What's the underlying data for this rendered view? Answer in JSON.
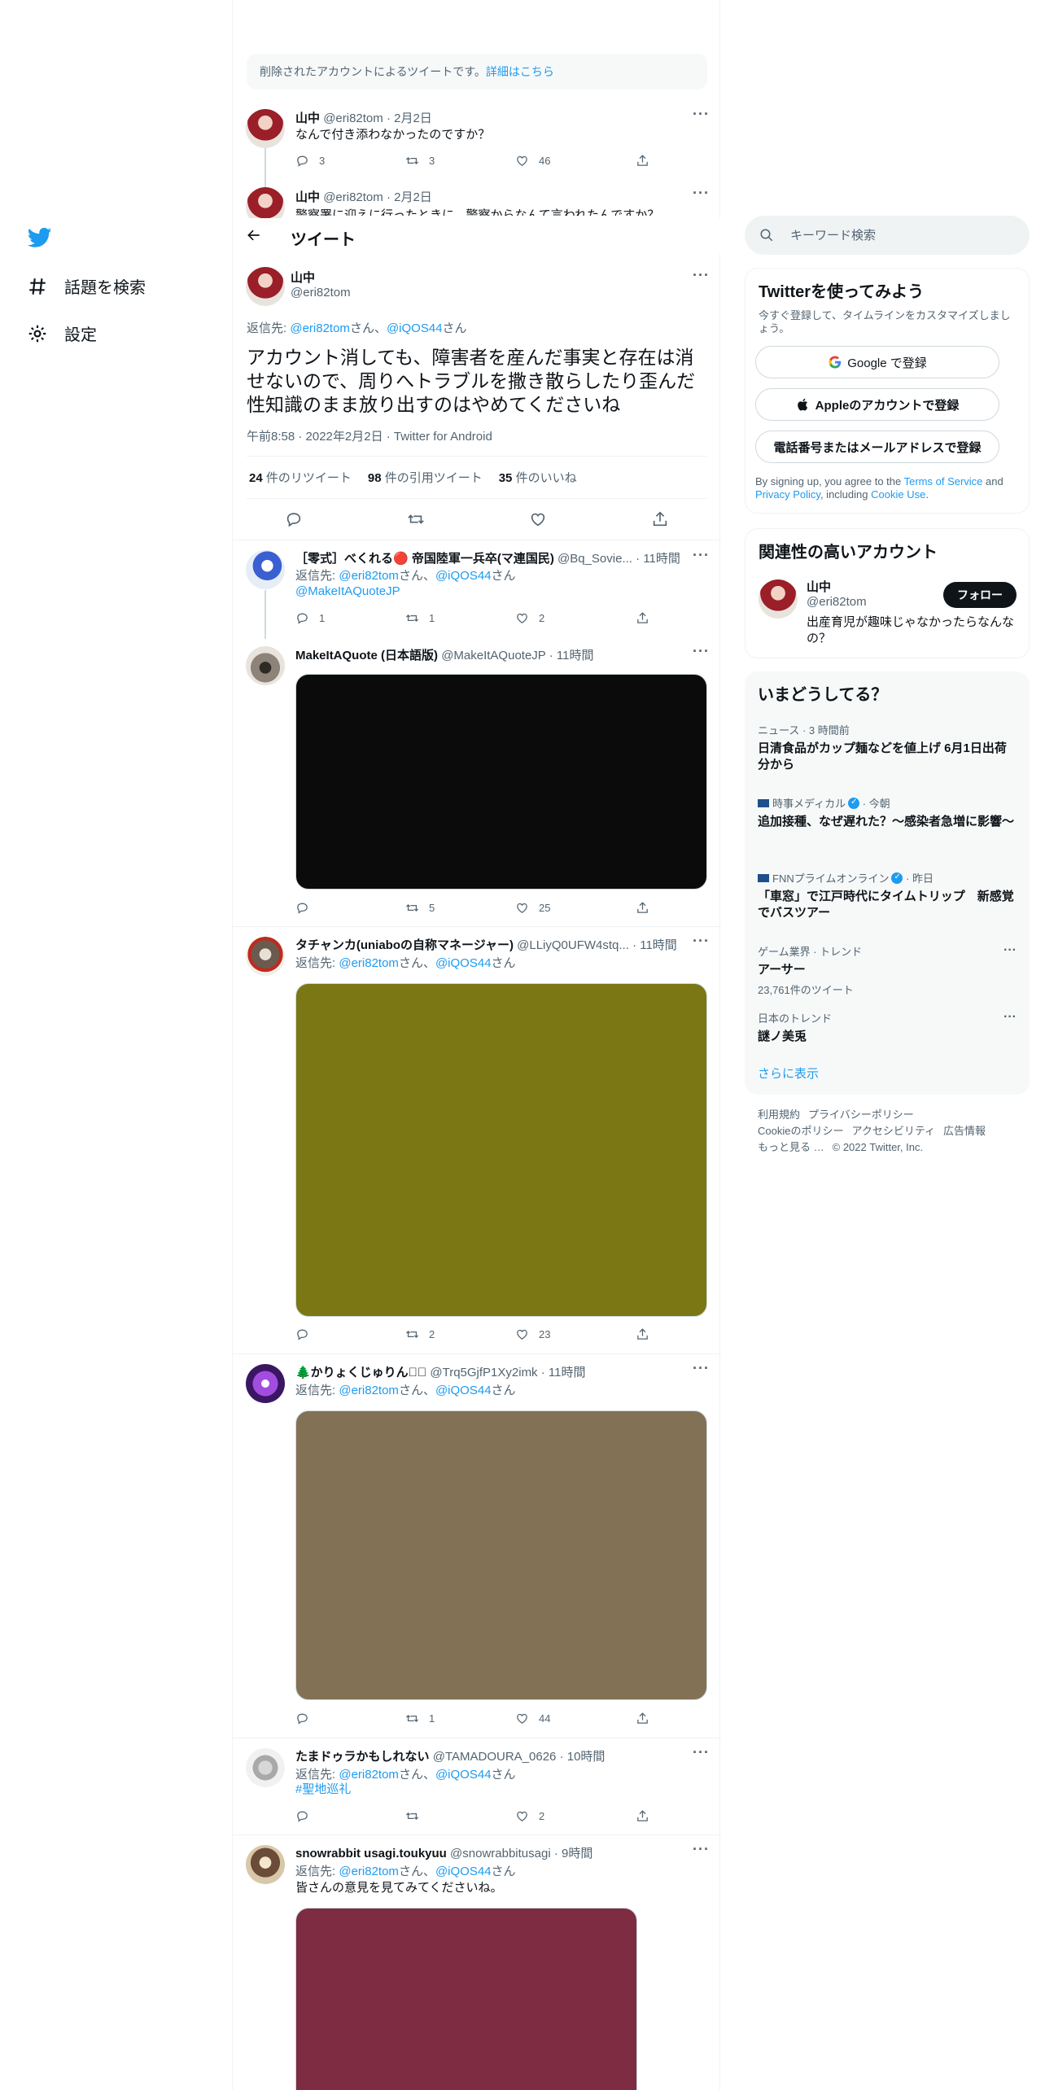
{
  "nav": {
    "logo": "twitter-bird-icon",
    "items": [
      {
        "label": "話題を検索",
        "icon": "hashtag-icon"
      },
      {
        "label": "設定",
        "icon": "gear-icon"
      }
    ]
  },
  "deleted_notice": {
    "text": "削除されたアカウントによるツイートです。",
    "link": "詳細はこちら"
  },
  "context_tweets": [
    {
      "name": "山中",
      "handle": "@eri82tom",
      "date": "2月2日",
      "text": "なんで付き添わなかったのですか？",
      "replies": "3",
      "retweets": "3",
      "likes": "46"
    },
    {
      "name": "山中",
      "handle": "@eri82tom",
      "date": "2月2日",
      "text": "警察署に迎えに行ったときに、警察からなんて言われたんですか？"
    }
  ],
  "header": {
    "title": "ツイート"
  },
  "main_tweet": {
    "name": "山中",
    "handle": "@eri82tom",
    "reply_prefix": "返信先: ",
    "reply_user1": "@eri82tom",
    "reply_sep": "さん、",
    "reply_user2": "@iQOS44",
    "reply_suffix": "さん",
    "text": "アカウント消しても、障害者を産んだ事実と存在は消せないので、周りへトラブルを撒き散らしたり歪んだ性知識のまま放り出すのはやめてくださいね",
    "timestamp": "午前8:58 · 2022年2月2日 · Twitter for Android",
    "retweets_count": "24",
    "retweets_label": " 件のリツイート",
    "quotes_count": "98",
    "quotes_label": " 件の引用ツイート",
    "likes_count": "35",
    "likes_label": " 件のいいね"
  },
  "replies": [
    {
      "name": "［零式］べくれる🔴 帝国陸軍一兵卒(マ連国民)",
      "handle": "@Bq_Sovie...",
      "time": "11時間",
      "reply_prefix": "返信先: ",
      "reply_user1": "@eri82tom",
      "reply_sep": "さん、",
      "reply_user2": "@iQOS44",
      "reply_suffix": "さん",
      "text": "@MakeItAQuoteJP",
      "replies": "1",
      "retweets": "1",
      "likes": "2"
    },
    {
      "name": "MakeItAQuote (日本語版)",
      "handle": "@MakeItAQuoteJP",
      "time": "11時間",
      "media_color": "#0b0b0b",
      "replies": "",
      "retweets": "5",
      "likes": "25"
    },
    {
      "name": "タチャンカ(uniaboの自称マネージャー)",
      "handle": "@LLiyQ0UFW4stq...",
      "time": "11時間",
      "reply_prefix": "返信先: ",
      "reply_user1": "@eri82tom",
      "reply_sep": "さん、",
      "reply_user2": "@iQOS44",
      "reply_suffix": "さん",
      "media_color": "#7a7714",
      "replies": "",
      "retweets": "2",
      "likes": "23"
    },
    {
      "name": "🌲かりょくじゅりん！🏻",
      "handle": "@Trq5GjfP1Xy2imk",
      "time": "11時間",
      "reply_prefix": "返信先: ",
      "reply_user1": "@eri82tom",
      "reply_sep": "さん、",
      "reply_user2": "@iQOS44",
      "reply_suffix": "さん",
      "media_color": "#827155",
      "replies": "",
      "retweets": "1",
      "likes": "44"
    },
    {
      "name": "たまドゥラかもしれない",
      "handle": "@TAMADOURA_0626",
      "time": "10時間",
      "reply_prefix": "返信先: ",
      "reply_user1": "@eri82tom",
      "reply_sep": "さん、",
      "reply_user2": "@iQOS44",
      "reply_suffix": "さん",
      "text": "#聖地巡礼",
      "replies": "",
      "retweets": "",
      "likes": "2"
    },
    {
      "name": "snowrabbit usagi.toukyuu",
      "handle": "@snowrabbitusagi",
      "time": "9時間",
      "reply_prefix": "返信先: ",
      "reply_user1": "@eri82tom",
      "reply_sep": "さん、",
      "reply_user2": "@iQOS44",
      "reply_suffix": "さん",
      "text": "皆さんの意見を見てみてくださいね。",
      "media_color": "#7d2c41"
    }
  ],
  "search": {
    "placeholder": "キーワード検索"
  },
  "signup": {
    "title": "Twitterを使ってみよう",
    "desc": "今すぐ登録して、タイムラインをカスタマイズしましょう。",
    "google": "Google で登録",
    "apple": "Appleのアカウントで登録",
    "phone": "電話番号またはメールアドレスで登録",
    "terms_prefix": "By signing up, you agree to the ",
    "terms_link": "Terms of Service",
    "terms_and": " and ",
    "privacy_link": "Privacy Policy",
    "terms_including": ", including ",
    "cookie_link": "Cookie Use",
    "terms_end": "."
  },
  "related": {
    "title": "関連性の高いアカウント",
    "name": "山中",
    "handle": "@eri82tom",
    "bio": "出産育児が趣味じゃなかったらなんなの？",
    "follow": "フォロー"
  },
  "trends": {
    "title": "いまどうしてる？",
    "items": [
      {
        "meta": "ニュース · 3 時間前",
        "title": "日清食品がカップ麺などを値上げ 6月1日出荷分から"
      },
      {
        "meta_source": "時事メディカル",
        "meta_time": " · 今朝",
        "title": "追加接種、なぜ遅れた？～感染者急増に影響～"
      },
      {
        "meta_source": "FNNプライムオンライン",
        "meta_time": " · 昨日",
        "title": "「車窓」で江戸時代にタイムトリップ　新感覚でバスツアー"
      },
      {
        "meta": "ゲーム業界 · トレンド",
        "title": "アーサー",
        "count": "23,761件のツイート"
      },
      {
        "meta": "日本のトレンド",
        "title": "謎ノ美兎"
      }
    ],
    "show_more": "さらに表示"
  },
  "footer": {
    "links": [
      "利用規約",
      "プライバシーポリシー",
      "Cookieのポリシー",
      "アクセシビリティ",
      "広告情報",
      "もっと見る …"
    ],
    "copyright": "© 2022 Twitter, Inc."
  }
}
